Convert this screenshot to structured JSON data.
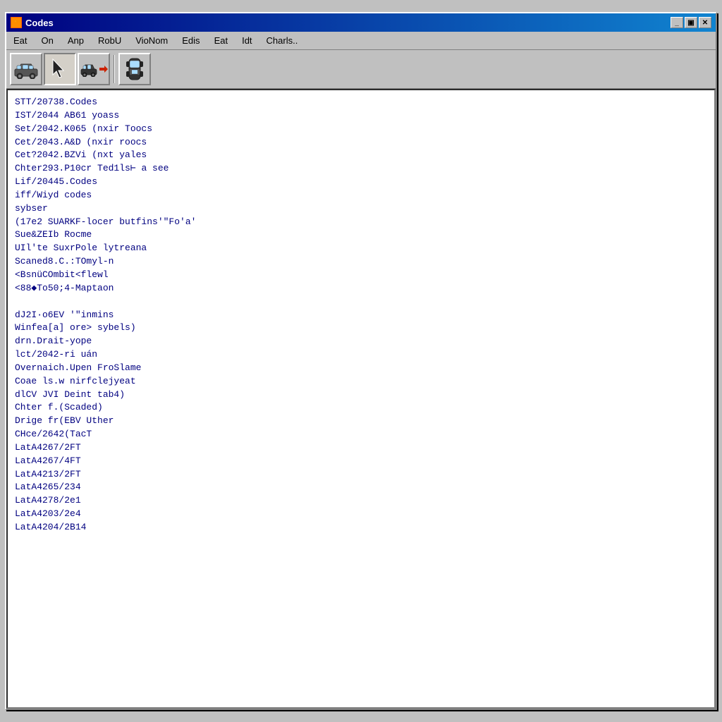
{
  "window": {
    "title": "Codes",
    "title_icon": "🔸"
  },
  "title_buttons": {
    "minimize": "_",
    "restore": "▣",
    "close": "✕"
  },
  "menu": {
    "items": [
      {
        "label": "Eat"
      },
      {
        "label": "On"
      },
      {
        "label": "Anp"
      },
      {
        "label": "RobU"
      },
      {
        "label": "VioNom"
      },
      {
        "label": "Edis"
      },
      {
        "label": "Eat"
      },
      {
        "label": "Idt"
      },
      {
        "label": "Charls.."
      }
    ]
  },
  "toolbar": {
    "buttons": [
      {
        "id": "car1",
        "icon": "🚗",
        "type": "car"
      },
      {
        "id": "cursor",
        "icon": "🖱",
        "type": "cursor",
        "active": true
      },
      {
        "id": "car-arrow",
        "icon": "🚗➡",
        "type": "car-arrow"
      },
      {
        "id": "car-top",
        "icon": "🚘",
        "type": "car-top"
      }
    ]
  },
  "content": {
    "lines": [
      "STT/20738.Codes",
      "IST/2044 AB61 yoass",
      "Set/2042.K065 (nxir Toocs",
      "Cet/2043.A&D (nxir roocs",
      "Cet?2042.BZVi (nxt yales",
      "Chter293.P10cr Ted1ls⊢ a see",
      "Lif/20445.Codes",
      "iff/Wiyd codes",
      "sybser",
      "(17e2 SUARKF-locer butfins'\"Fo'a'",
      "Sue&ZEIb Rocme",
      "UIl'te SuxrPole lytreana",
      "Scaned8.C.:TOmyl-n",
      "<BsnüCOmbit<flewl",
      "<88◆To50;4-Maptaon",
      "",
      "dJ2I·o6EV '\"inmins",
      "Winfea[a] ore> sybels)",
      "drn.Drait-yope",
      "lct/2042-ri uán",
      "Overnaich.Upen FroSlame",
      "Coae ls.w nirfclejyeat",
      "dlCV JVI Deint tab4)",
      "Chter f.(Scaded)",
      "Drige fr(EBV Uther",
      "CHce/2642(TacT",
      "LatA4267/2FT",
      "LatA4267/4FT",
      "LatA4213/2FT",
      "LatA4265/234",
      "LatA4278/2e1",
      "LatA4203/2e4",
      "LatA4204/2B14"
    ]
  }
}
